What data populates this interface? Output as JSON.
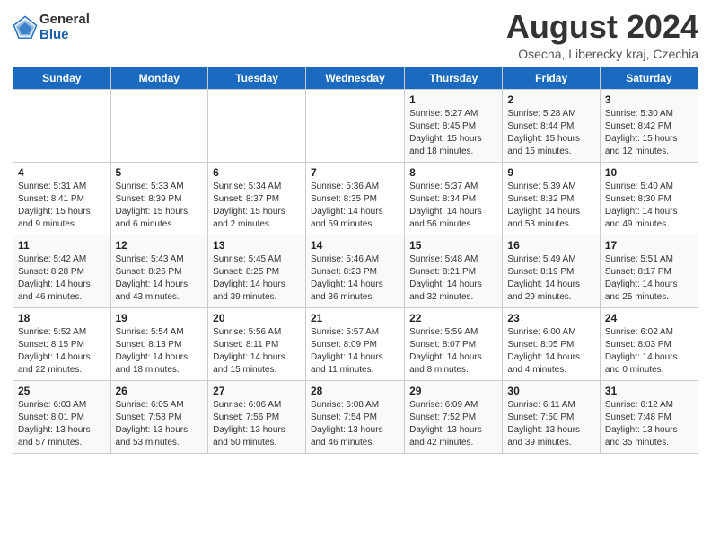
{
  "header": {
    "logo_general": "General",
    "logo_blue": "Blue",
    "month_title": "August 2024",
    "location": "Osecna, Liberecky kraj, Czechia"
  },
  "days_of_week": [
    "Sunday",
    "Monday",
    "Tuesday",
    "Wednesday",
    "Thursday",
    "Friday",
    "Saturday"
  ],
  "weeks": [
    [
      {
        "day": "",
        "info": ""
      },
      {
        "day": "",
        "info": ""
      },
      {
        "day": "",
        "info": ""
      },
      {
        "day": "",
        "info": ""
      },
      {
        "day": "1",
        "info": "Sunrise: 5:27 AM\nSunset: 8:45 PM\nDaylight: 15 hours\nand 18 minutes."
      },
      {
        "day": "2",
        "info": "Sunrise: 5:28 AM\nSunset: 8:44 PM\nDaylight: 15 hours\nand 15 minutes."
      },
      {
        "day": "3",
        "info": "Sunrise: 5:30 AM\nSunset: 8:42 PM\nDaylight: 15 hours\nand 12 minutes."
      }
    ],
    [
      {
        "day": "4",
        "info": "Sunrise: 5:31 AM\nSunset: 8:41 PM\nDaylight: 15 hours\nand 9 minutes."
      },
      {
        "day": "5",
        "info": "Sunrise: 5:33 AM\nSunset: 8:39 PM\nDaylight: 15 hours\nand 6 minutes."
      },
      {
        "day": "6",
        "info": "Sunrise: 5:34 AM\nSunset: 8:37 PM\nDaylight: 15 hours\nand 2 minutes."
      },
      {
        "day": "7",
        "info": "Sunrise: 5:36 AM\nSunset: 8:35 PM\nDaylight: 14 hours\nand 59 minutes."
      },
      {
        "day": "8",
        "info": "Sunrise: 5:37 AM\nSunset: 8:34 PM\nDaylight: 14 hours\nand 56 minutes."
      },
      {
        "day": "9",
        "info": "Sunrise: 5:39 AM\nSunset: 8:32 PM\nDaylight: 14 hours\nand 53 minutes."
      },
      {
        "day": "10",
        "info": "Sunrise: 5:40 AM\nSunset: 8:30 PM\nDaylight: 14 hours\nand 49 minutes."
      }
    ],
    [
      {
        "day": "11",
        "info": "Sunrise: 5:42 AM\nSunset: 8:28 PM\nDaylight: 14 hours\nand 46 minutes."
      },
      {
        "day": "12",
        "info": "Sunrise: 5:43 AM\nSunset: 8:26 PM\nDaylight: 14 hours\nand 43 minutes."
      },
      {
        "day": "13",
        "info": "Sunrise: 5:45 AM\nSunset: 8:25 PM\nDaylight: 14 hours\nand 39 minutes."
      },
      {
        "day": "14",
        "info": "Sunrise: 5:46 AM\nSunset: 8:23 PM\nDaylight: 14 hours\nand 36 minutes."
      },
      {
        "day": "15",
        "info": "Sunrise: 5:48 AM\nSunset: 8:21 PM\nDaylight: 14 hours\nand 32 minutes."
      },
      {
        "day": "16",
        "info": "Sunrise: 5:49 AM\nSunset: 8:19 PM\nDaylight: 14 hours\nand 29 minutes."
      },
      {
        "day": "17",
        "info": "Sunrise: 5:51 AM\nSunset: 8:17 PM\nDaylight: 14 hours\nand 25 minutes."
      }
    ],
    [
      {
        "day": "18",
        "info": "Sunrise: 5:52 AM\nSunset: 8:15 PM\nDaylight: 14 hours\nand 22 minutes."
      },
      {
        "day": "19",
        "info": "Sunrise: 5:54 AM\nSunset: 8:13 PM\nDaylight: 14 hours\nand 18 minutes."
      },
      {
        "day": "20",
        "info": "Sunrise: 5:56 AM\nSunset: 8:11 PM\nDaylight: 14 hours\nand 15 minutes."
      },
      {
        "day": "21",
        "info": "Sunrise: 5:57 AM\nSunset: 8:09 PM\nDaylight: 14 hours\nand 11 minutes."
      },
      {
        "day": "22",
        "info": "Sunrise: 5:59 AM\nSunset: 8:07 PM\nDaylight: 14 hours\nand 8 minutes."
      },
      {
        "day": "23",
        "info": "Sunrise: 6:00 AM\nSunset: 8:05 PM\nDaylight: 14 hours\nand 4 minutes."
      },
      {
        "day": "24",
        "info": "Sunrise: 6:02 AM\nSunset: 8:03 PM\nDaylight: 14 hours\nand 0 minutes."
      }
    ],
    [
      {
        "day": "25",
        "info": "Sunrise: 6:03 AM\nSunset: 8:01 PM\nDaylight: 13 hours\nand 57 minutes."
      },
      {
        "day": "26",
        "info": "Sunrise: 6:05 AM\nSunset: 7:58 PM\nDaylight: 13 hours\nand 53 minutes."
      },
      {
        "day": "27",
        "info": "Sunrise: 6:06 AM\nSunset: 7:56 PM\nDaylight: 13 hours\nand 50 minutes."
      },
      {
        "day": "28",
        "info": "Sunrise: 6:08 AM\nSunset: 7:54 PM\nDaylight: 13 hours\nand 46 minutes."
      },
      {
        "day": "29",
        "info": "Sunrise: 6:09 AM\nSunset: 7:52 PM\nDaylight: 13 hours\nand 42 minutes."
      },
      {
        "day": "30",
        "info": "Sunrise: 6:11 AM\nSunset: 7:50 PM\nDaylight: 13 hours\nand 39 minutes."
      },
      {
        "day": "31",
        "info": "Sunrise: 6:12 AM\nSunset: 7:48 PM\nDaylight: 13 hours\nand 35 minutes."
      }
    ]
  ]
}
